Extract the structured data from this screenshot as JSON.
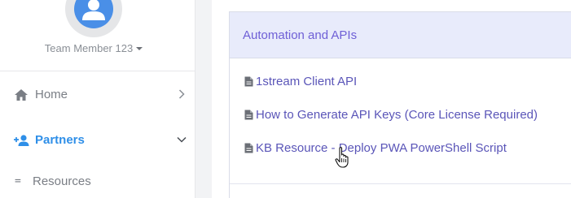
{
  "sidebar": {
    "user": {
      "name": "Team Member 123"
    },
    "items": [
      {
        "label": "Home",
        "icon": "home-icon",
        "active": false,
        "chevron": "right"
      },
      {
        "label": "Partners",
        "icon": "user-plus-icon",
        "active": true,
        "chevron": "down"
      },
      {
        "label": "Resources",
        "icon": "equals-icon",
        "active": false
      }
    ]
  },
  "main": {
    "section": {
      "title": "Automation and APIs",
      "articles": [
        {
          "title": "1stream Client API",
          "icon": "document-icon"
        },
        {
          "title": "How to Generate API Keys (Core License Required)",
          "icon": "document-icon"
        },
        {
          "title": "KB Resource - Deploy PWA PowerShell Script",
          "icon": "document-icon"
        }
      ]
    }
  },
  "colors": {
    "accent": "#2f8fe8",
    "link": "#5a55b8",
    "header_bg": "#e8ebfb",
    "title": "#6e5fd6",
    "avatar": "#4a8fe7"
  }
}
